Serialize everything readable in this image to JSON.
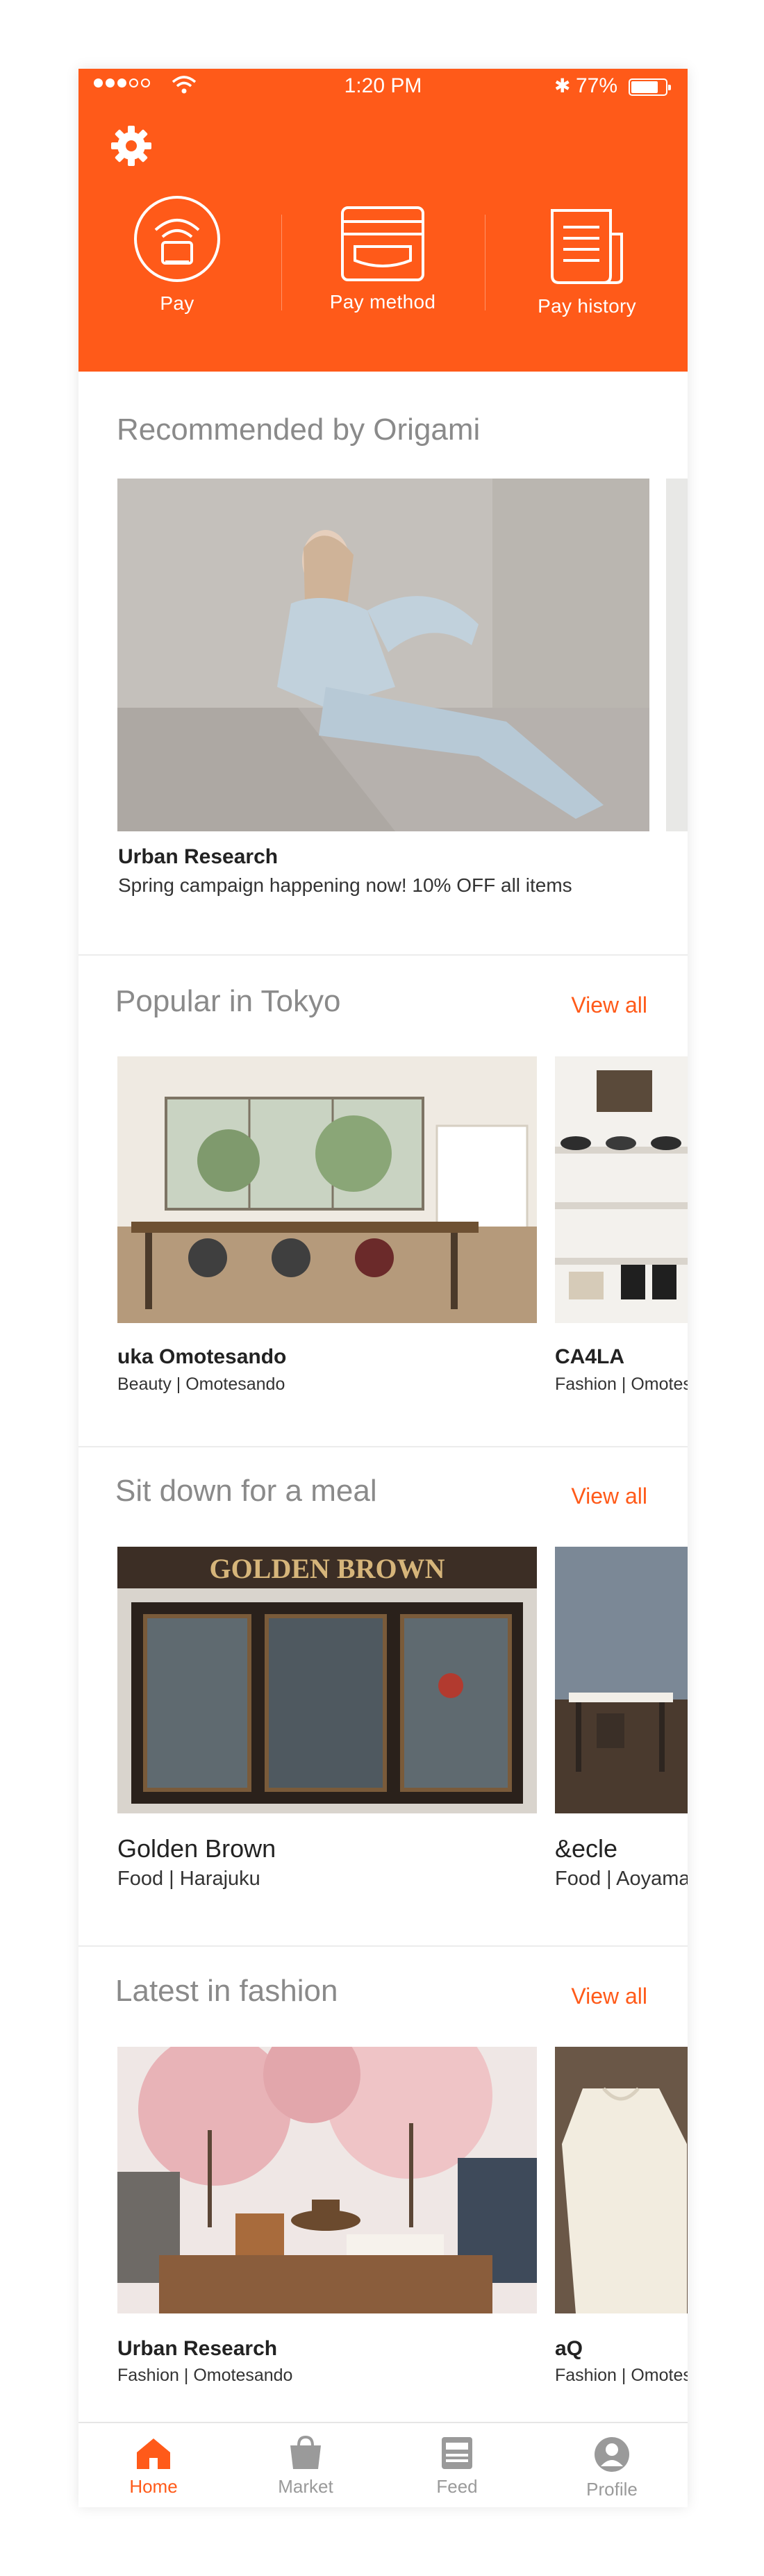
{
  "status_bar": {
    "time": "1:20 PM",
    "battery": "77%"
  },
  "header_actions": [
    {
      "label": "Pay",
      "icon": "pay-icon"
    },
    {
      "label": "Pay method",
      "icon": "pay-method-icon"
    },
    {
      "label": "Pay history",
      "icon": "pay-history-icon"
    }
  ],
  "recommended": {
    "title": "Recommended by Origami",
    "card": {
      "title": "Urban Research",
      "subtitle": "Spring campaign happening now! 10% OFF all items"
    }
  },
  "popular": {
    "title": "Popular in Tokyo",
    "view_all": "View all",
    "cards": [
      {
        "title": "uka Omotesando",
        "subtitle": "Beauty | Omotesando"
      },
      {
        "title": "CA4LA",
        "subtitle": "Fashion | Omotes"
      }
    ]
  },
  "meal": {
    "title": "Sit down for a meal",
    "view_all": "View all",
    "sign_text": "GOLDEN BROWN",
    "cards": [
      {
        "title": "Golden Brown",
        "subtitle": "Food | Harajuku"
      },
      {
        "title": "&ecle",
        "subtitle": "Food | Aoyama"
      }
    ]
  },
  "fashion": {
    "title": "Latest in fashion",
    "view_all": "View all",
    "cards": [
      {
        "title": "Urban Research",
        "subtitle": "Fashion  |  Omotesando"
      },
      {
        "title": "aQ",
        "subtitle": "Fashion | Omotes"
      }
    ]
  },
  "tabs": [
    {
      "label": "Home",
      "icon": "home-icon",
      "active": true
    },
    {
      "label": "Market",
      "icon": "shopping-bag-icon",
      "active": false
    },
    {
      "label": "Feed",
      "icon": "feed-icon",
      "active": false
    },
    {
      "label": "Profile",
      "icon": "profile-icon",
      "active": false
    }
  ],
  "colors": {
    "accent": "#ff5a19",
    "title_gray": "#8a8a8a",
    "tab_inactive": "#9a9a9a"
  }
}
